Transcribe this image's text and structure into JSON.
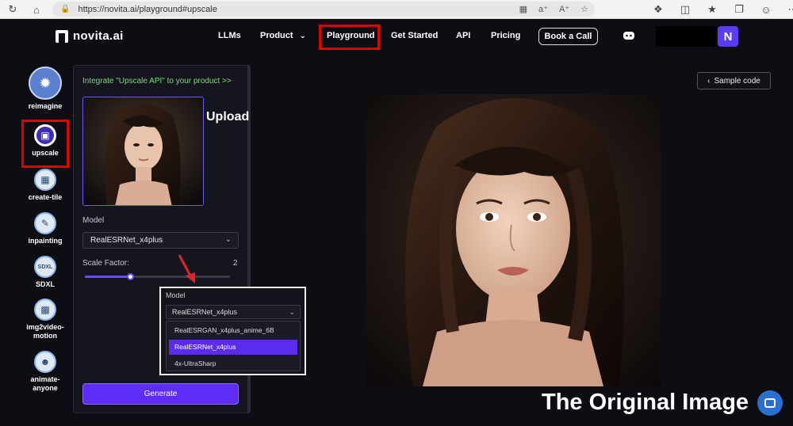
{
  "browser": {
    "url": "https://novita.ai/playground#upscale",
    "icons": [
      "reload-icon",
      "home-icon",
      "lock-icon",
      "grid-icon",
      "read-aloud-icon",
      "text-size-icon",
      "star-icon",
      "extensions-icon",
      "split-view-icon",
      "favorites-icon",
      "collections-icon",
      "profile-icon"
    ]
  },
  "header": {
    "brand": "novita.ai",
    "nav": [
      {
        "label": "LLMs"
      },
      {
        "label": "Product"
      },
      {
        "label": "Playground"
      },
      {
        "label": "Get Started"
      },
      {
        "label": "API"
      },
      {
        "label": "Pricing"
      }
    ],
    "book_call": "Book a Call",
    "avatar_letter": "N"
  },
  "tools": [
    {
      "label": "reimagine"
    },
    {
      "label": "upscale"
    },
    {
      "label": "create-tile"
    },
    {
      "label": "inpainting"
    },
    {
      "label": "SDXL",
      "icon_text": "SDXL"
    },
    {
      "label": "img2video-motion"
    },
    {
      "label": "animate-anyone"
    }
  ],
  "panel": {
    "integrate_link": "Integrate \"Upscale API\" to your product >>",
    "upload_label": "Upload",
    "model_label": "Model",
    "model_value": "RealESRNet_x4plus",
    "scale_label": "Scale Factor:",
    "scale_value": "2",
    "scale_fraction": 0.31,
    "generate": "Generate"
  },
  "dropdown": {
    "label": "Model",
    "selected": "RealESRNet_x4plus",
    "options": [
      {
        "label": "RealESRGAN_x4plus_anime_6B"
      },
      {
        "label": "RealESRNet_x4plus"
      },
      {
        "label": "4x-UltraSharp"
      }
    ],
    "selected_index": 1
  },
  "result": {
    "sample_code": "Sample code",
    "caption": "The Original Image"
  }
}
